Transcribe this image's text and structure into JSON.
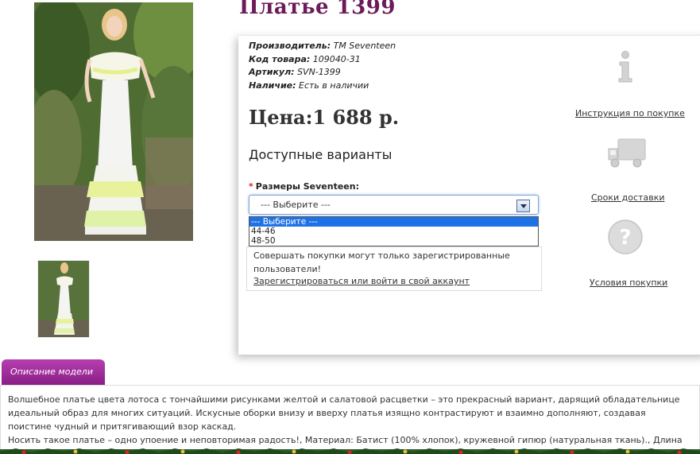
{
  "product": {
    "title": "Платье 1399",
    "manufacturer_label": "Производитель:",
    "manufacturer": "ТМ Seventeen",
    "code_label": "Код товара:",
    "code": "109040-31",
    "article_label": "Артикул:",
    "article": "SVN-1399",
    "availability_label": "Наличие:",
    "availability": "Есть в наличии",
    "price": "Цена:1 688 р."
  },
  "options": {
    "heading": "Доступные варианты",
    "size_label": "Размеры Seventeen:",
    "required_mark": "*",
    "select_value": "--- Выберите ---",
    "dropdown_options": [
      "--- Выберите ---",
      "44-46",
      "48-50"
    ]
  },
  "notice": {
    "message": "Совершать покупки могут только зарегистрированные пользователи!",
    "login_link": "Зарегистрироваться или войти в свой аккаунт"
  },
  "side_links": {
    "instructions": "Инструкция по покупке",
    "delivery": "Сроки доставки",
    "conditions": "Условия покупки"
  },
  "icons": {
    "info": "info-icon",
    "delivery": "truck-icon",
    "conditions": "question-icon"
  },
  "description": {
    "tab_label": "Описание модели",
    "line1": "Волшебное платье цвета лотоса с тончайшими рисунками желтой и салатовой расцветки – это прекрасный вариант, дарящий обладательнице идеальный образ для многих ситуаций. Искусные оборки внизу и вверху платья изящно контрастируют и взаимно дополняют, создавая поистине чудный и притягивающий взор каскад.",
    "line2": "Носить такое платье – одно упоение и неповторимая радость!, Материал: Батист (100% хлопок), кружевной гипюр (натуральная ткань)., Длина изделия без"
  },
  "colors": {
    "title": "#6b1a5a",
    "tab": "#9b2b96",
    "dropdown_highlight": "#1e72e6"
  }
}
